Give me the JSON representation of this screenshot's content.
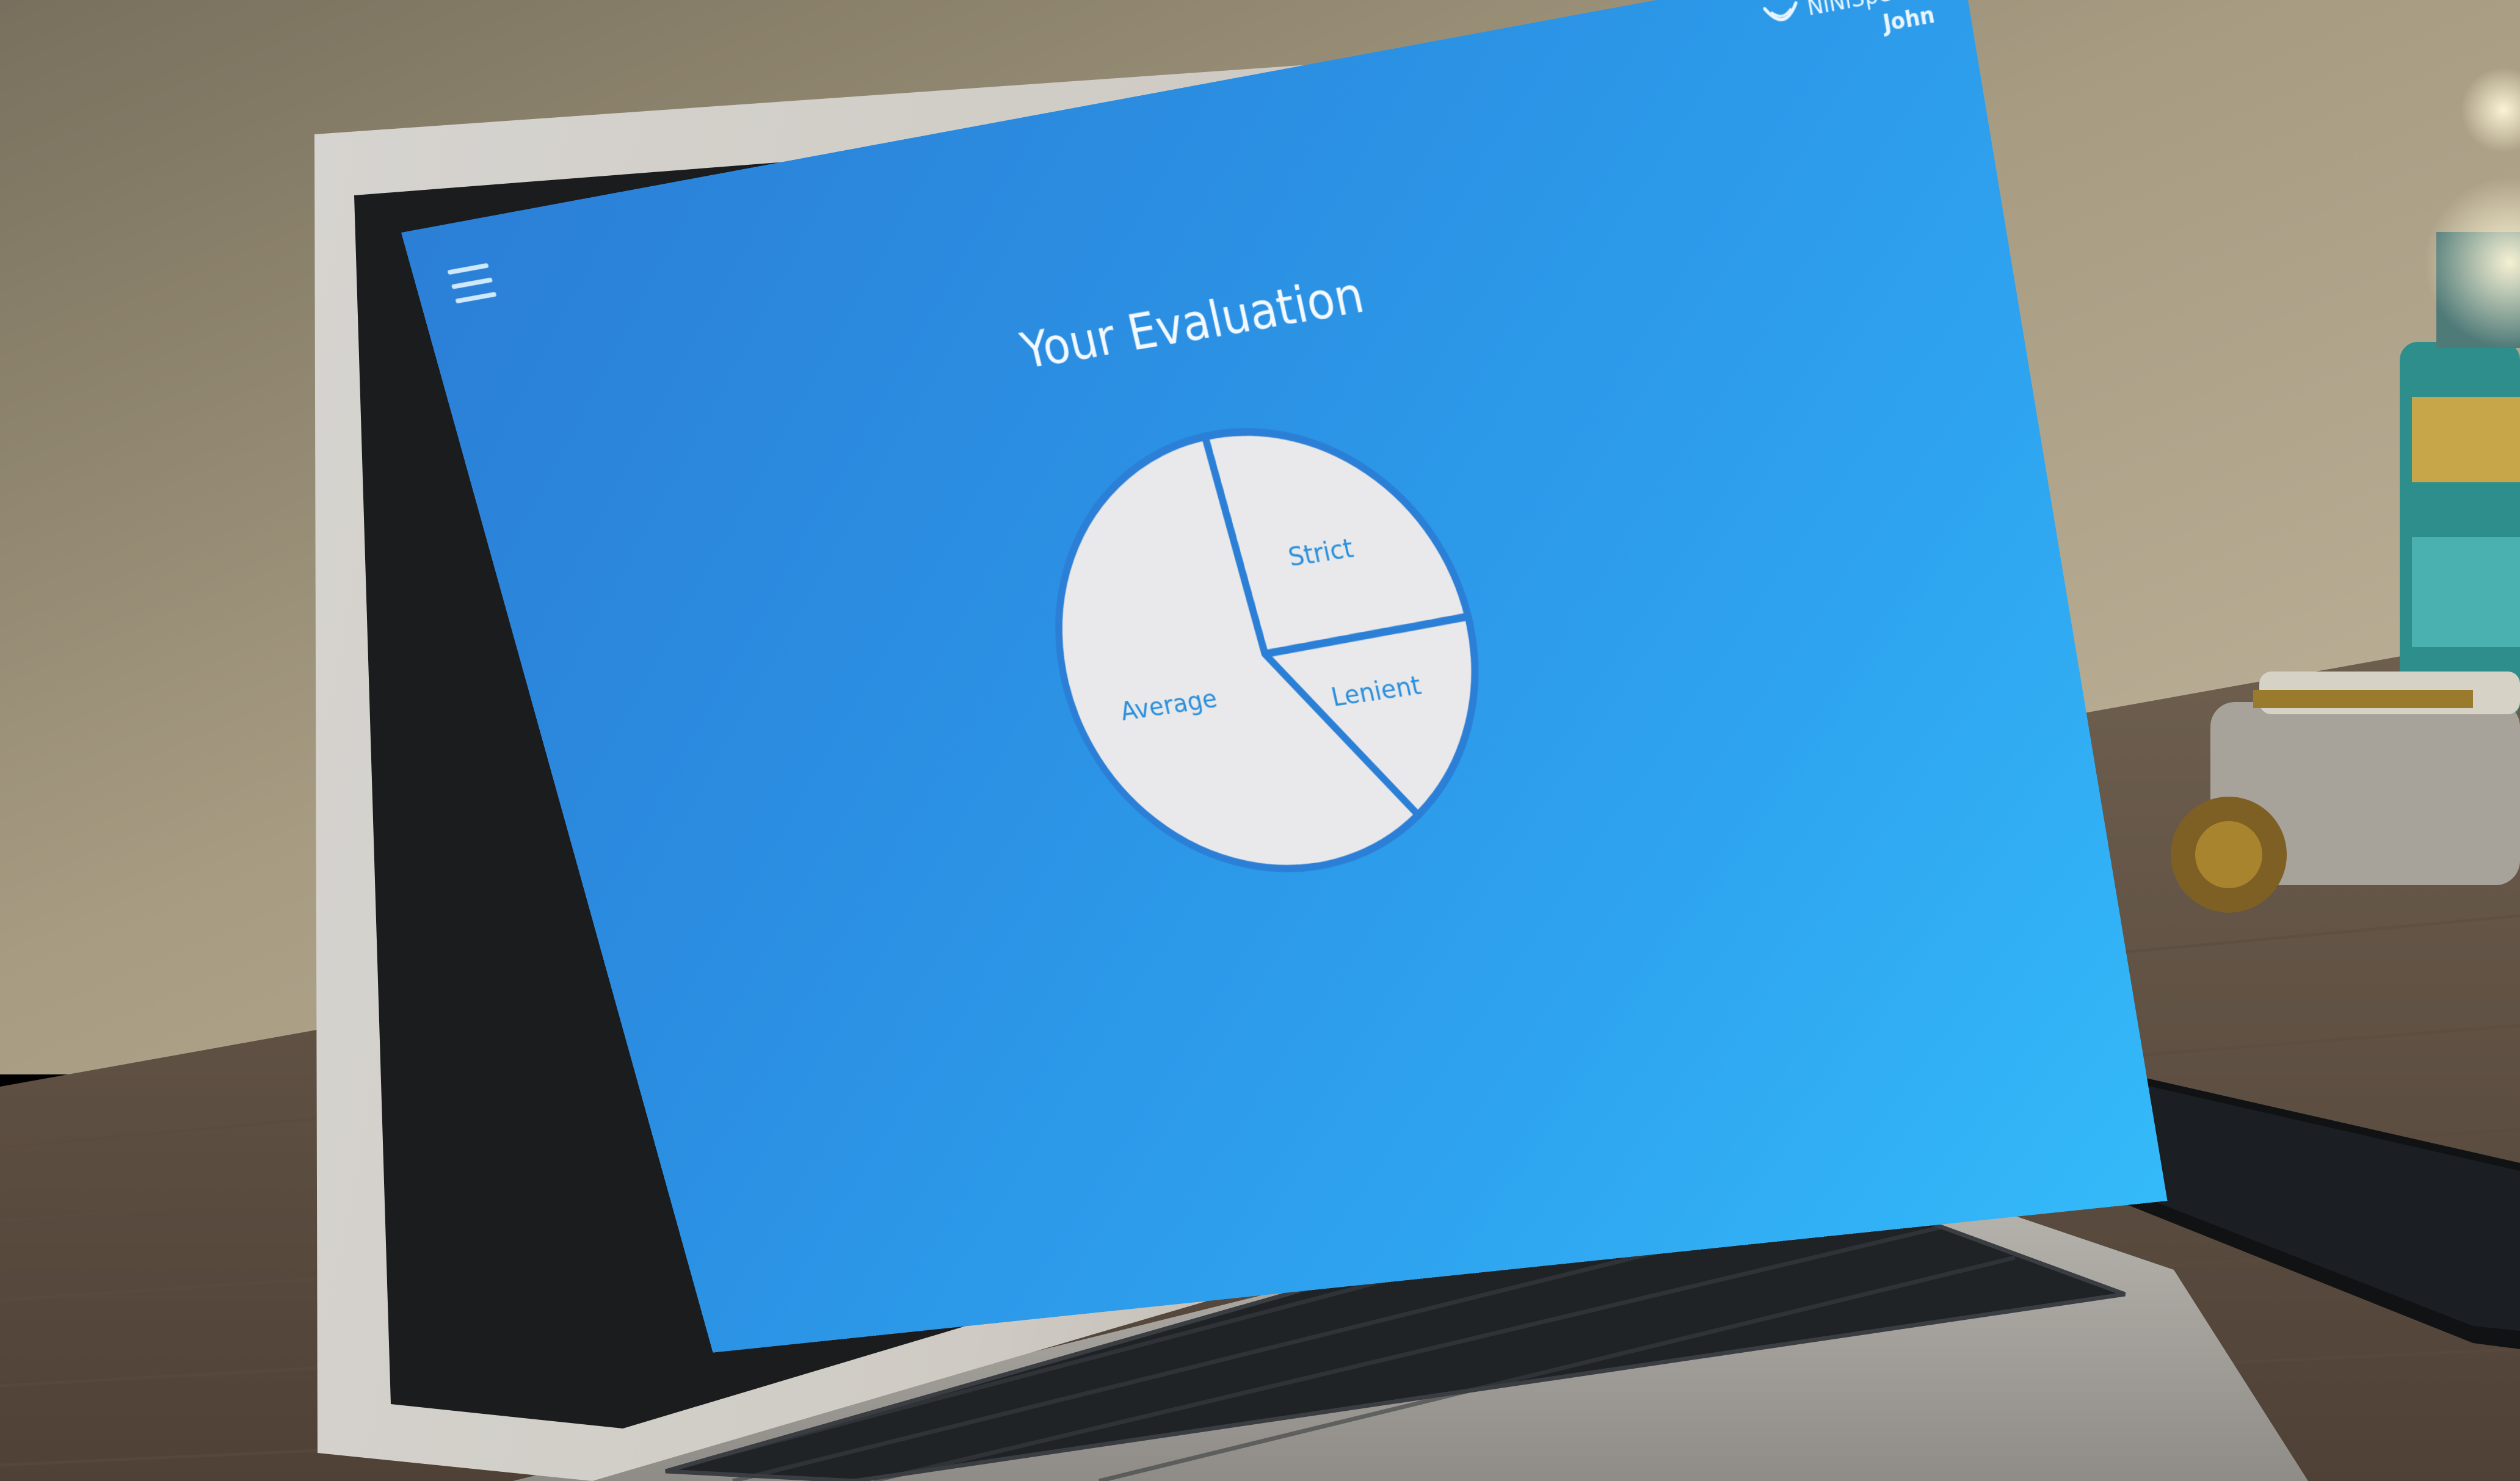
{
  "app": {
    "brand_name": "NiNiSpeech",
    "user_name": "John"
  },
  "page": {
    "title": "Your Evaluation"
  },
  "icons": {
    "menu": "hamburger-menu-icon",
    "brand": "smile-logo-icon"
  },
  "colors": {
    "screen_top_right": "#34baf9",
    "screen_bottom_left": "#2b7fd6",
    "slice_fill": "#e9e9eb",
    "slice_label": "#2a8fdc"
  },
  "chart_data": {
    "type": "pie",
    "title": "",
    "start_angle_deg": -3,
    "direction": "clockwise",
    "labels": [
      "Strict",
      "Lenient",
      "Average"
    ],
    "values": [
      25.3,
      16.0,
      58.7
    ],
    "legend": false
  }
}
